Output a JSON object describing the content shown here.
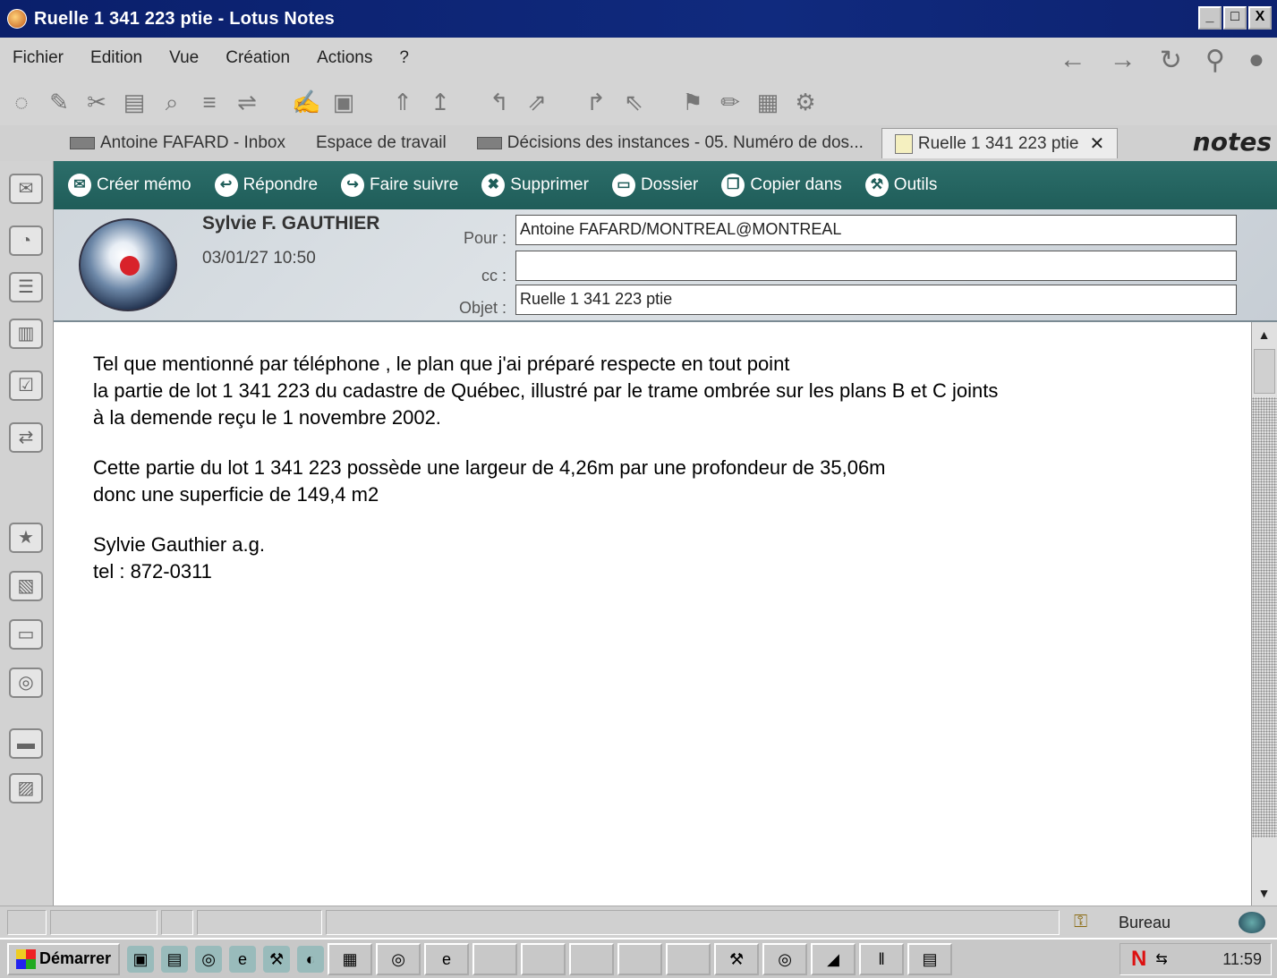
{
  "window": {
    "title": "Ruelle 1 341 223 ptie - Lotus Notes",
    "minimize": "_",
    "maximize": "□",
    "close": "X"
  },
  "menu": {
    "items": [
      "Fichier",
      "Edition",
      "Vue",
      "Création",
      "Actions",
      "?"
    ]
  },
  "tabs": [
    {
      "label": "Antoine FAFARD - Inbox"
    },
    {
      "label": "Espace de travail"
    },
    {
      "label": "Décisions des instances - 05. Numéro de dos..."
    },
    {
      "label": "Ruelle 1 341 223 ptie",
      "close": "✕"
    }
  ],
  "brand": "notes",
  "actions": [
    {
      "label": "Créer mémo",
      "icon": "memo-icon"
    },
    {
      "label": "Répondre",
      "icon": "reply-icon"
    },
    {
      "label": "Faire suivre",
      "icon": "forward-icon"
    },
    {
      "label": "Supprimer",
      "icon": "delete-icon"
    },
    {
      "label": "Dossier",
      "icon": "folder-icon"
    },
    {
      "label": "Copier dans",
      "icon": "copy-icon"
    },
    {
      "label": "Outils",
      "icon": "tools-icon"
    }
  ],
  "message": {
    "sender": "Sylvie F. GAUTHIER",
    "date": "03/01/27 10:50",
    "to_label": "Pour :",
    "to": "Antoine FAFARD/MONTREAL@MONTREAL",
    "cc_label": "cc :",
    "cc": "",
    "subject_label": "Objet :",
    "subject": "Ruelle 1 341 223 ptie",
    "body_lines": [
      "Tel que mentionné par téléphone , le plan que j'ai préparé respecte en tout point",
      "la partie de lot 1 341 223 du cadastre de Québec, illustré par le trame ombrée sur les plans B et C joints",
      "à la demende reçu le 1 novembre 2002.",
      "Cette partie du lot 1 341 223 possède une largeur de 4,26m par une profondeur de 35,06m",
      "donc une superficie de 149,4 m2",
      "Sylvie Gauthier a.g.",
      "tel : 872-0311"
    ]
  },
  "status": {
    "location": "Bureau"
  },
  "taskbar": {
    "start": "Démarrer",
    "clock": "11:59"
  },
  "colors": {
    "titlebar": "#0a1f6b",
    "actionbar": "#1f5d59"
  }
}
